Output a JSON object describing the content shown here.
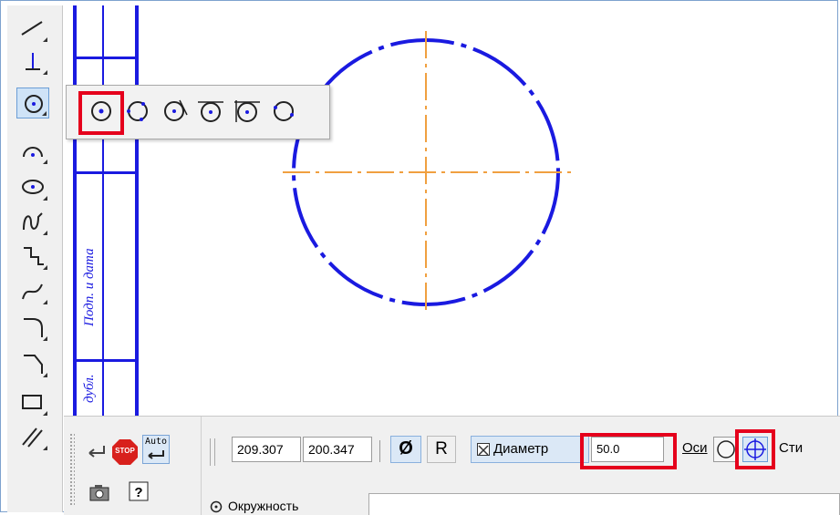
{
  "toolbar": {
    "tools": [
      {
        "icon": "line-segment-icon"
      },
      {
        "icon": "auxiliary-line-icon"
      },
      {
        "icon": "circle-center-icon",
        "active": true
      },
      {
        "icon": "arc-icon"
      },
      {
        "icon": "ellipse-icon"
      },
      {
        "icon": "spline-icon"
      },
      {
        "icon": "polyline-icon"
      },
      {
        "icon": "bezier-icon"
      },
      {
        "icon": "fillet-icon"
      },
      {
        "icon": "chamfer-icon"
      },
      {
        "icon": "rectangle-icon"
      },
      {
        "icon": "hatch-icon"
      }
    ]
  },
  "flyout": {
    "items": [
      {
        "icon": "circle-by-center-icon",
        "selected": true
      },
      {
        "icon": "circle-three-points-icon"
      },
      {
        "icon": "circle-center-tangent-icon"
      },
      {
        "icon": "circle-two-tangents-icon"
      },
      {
        "icon": "circle-three-tangents-icon"
      },
      {
        "icon": "circle-two-points-icon"
      }
    ]
  },
  "drawing": {
    "stamp_text_1": "Подп. и дата",
    "stamp_text_2": "дубл.",
    "circle_color": "#1a1ae0",
    "axis_color": "#f0a040"
  },
  "panel": {
    "coord_x": "209.307",
    "coord_y": "200.347",
    "diameter_symbol": "Ø",
    "radius_label": "R",
    "diameter_label": "Диаметр",
    "diameter_value": "50.0",
    "axes_label": "Оси",
    "style_label": "Сти",
    "auto_label": "Auto",
    "stop_label": "STOP",
    "tab_label": "Окружность"
  }
}
